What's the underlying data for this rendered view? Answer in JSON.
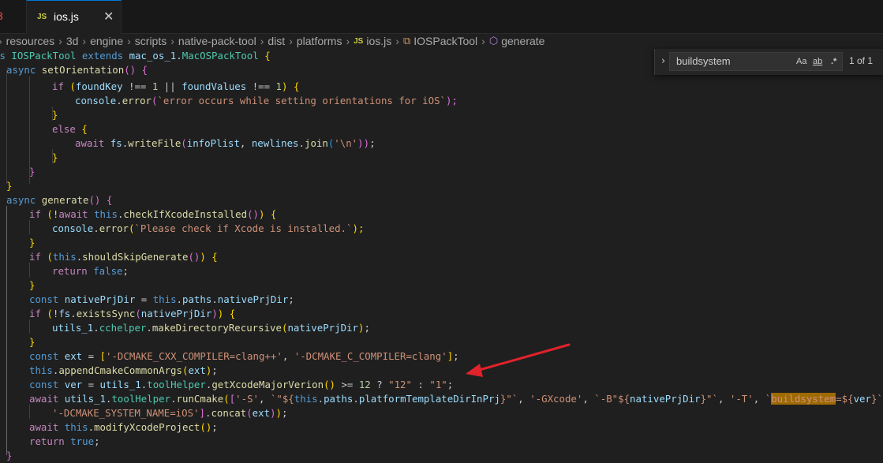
{
  "tabs": {
    "prev_tab_fragment": "3",
    "active": {
      "badge": "JS",
      "label": "ios.js",
      "close": "✕"
    }
  },
  "breadcrumb": {
    "items": [
      "resources",
      "3d",
      "engine",
      "scripts",
      "native-pack-tool",
      "dist",
      "platforms"
    ],
    "file": {
      "badge": "JS",
      "label": "ios.js"
    },
    "class_label": "IOSPackTool",
    "method_label": "generate"
  },
  "find": {
    "value": "buildsystem",
    "match_case": "Aa",
    "whole_word": "ab",
    "regex": ".*",
    "count": "1 of 1"
  },
  "code": {
    "l1": {
      "a": "ss ",
      "b": "IOSPackTool",
      "c": " extends ",
      "d": "mac_os_1",
      "e": ".",
      "f": "MacOSPackTool",
      "g": " {"
    },
    "l2": {
      "a": "async ",
      "b": "setOrientation",
      "c": "() {"
    },
    "l3": {
      "a": "if ",
      "b": "(",
      "c": "foundKey",
      "d": " !== ",
      "e": "1",
      "f": " || ",
      "g": "foundValues",
      "h": " !== ",
      "i": "1",
      "j": ")",
      "k": " {"
    },
    "l4": {
      "a": "console",
      "b": ".",
      "c": "error",
      "d": "(",
      "e": "`error occurs while setting orientations for iOS`",
      "f": ");"
    },
    "l5": {
      "a": "}"
    },
    "l6": {
      "a": "else ",
      "b": "{"
    },
    "l7": {
      "a": "await ",
      "b": "fs",
      "c": ".",
      "d": "writeFile",
      "e": "(",
      "f": "infoPlist",
      "g": ", ",
      "h": "newlines",
      "i": ".",
      "j": "join",
      "k": "(",
      "l": "'\\n'",
      "m": "))",
      "n": ";"
    },
    "l8": {
      "a": "}"
    },
    "l9": {
      "a": "}"
    },
    "l10": {
      "a": "}"
    },
    "l11": {
      "a": "async ",
      "b": "generate",
      "c": "() {"
    },
    "l12": {
      "a": "if ",
      "b": "(",
      "c": "!",
      "d": "await ",
      "e": "this",
      "f": ".",
      "g": "checkIfXcodeInstalled",
      "h": "()",
      "i": ")",
      "j": " {"
    },
    "l13": {
      "a": "console",
      "b": ".",
      "c": "error",
      "d": "(",
      "e": "`Please check if Xcode is installed.`",
      "f": ");"
    },
    "l14": {
      "a": "}"
    },
    "l15": {
      "a": "if ",
      "b": "(",
      "c": "this",
      "d": ".",
      "e": "shouldSkipGenerate",
      "f": "()",
      "g": ")",
      "h": " {"
    },
    "l16": {
      "a": "return ",
      "b": "false",
      "c": ";"
    },
    "l17": {
      "a": "}"
    },
    "l18": {
      "a": "const ",
      "b": "nativePrjDir",
      "c": " = ",
      "d": "this",
      "e": ".",
      "f": "paths",
      "g": ".",
      "h": "nativePrjDir",
      "i": ";"
    },
    "l19": {
      "a": "if ",
      "b": "(",
      "c": "!",
      "d": "fs",
      "e": ".",
      "f": "existsSync",
      "g": "(",
      "h": "nativePrjDir",
      "i": ")",
      "j": ")",
      "k": " {"
    },
    "l20": {
      "a": "utils_1",
      "b": ".",
      "c": "cchelper",
      "d": ".",
      "e": "makeDirectoryRecursive",
      "f": "(",
      "g": "nativePrjDir",
      "h": ")",
      "i": ";"
    },
    "l21": {
      "a": "}"
    },
    "l22": {
      "a": "const ",
      "b": "ext",
      "c": " = ",
      "d": "[",
      "e": "'-DCMAKE_CXX_COMPILER=clang++'",
      "f": ", ",
      "g": "'-DCMAKE_C_COMPILER=clang'",
      "h": "]",
      "i": ";"
    },
    "l23": {
      "a": "this",
      "b": ".",
      "c": "appendCmakeCommonArgs",
      "d": "(",
      "e": "ext",
      "f": ")",
      "g": ";"
    },
    "l24": {
      "a": "const ",
      "b": "ver",
      "c": " = ",
      "d": "utils_1",
      "e": ".",
      "f": "toolHelper",
      "g": ".",
      "h": "getXcodeMajorVerion",
      "i": "()",
      "j": " >= ",
      "k": "12",
      "l": " ? ",
      "m": "\"12\"",
      "n": " : ",
      "o": "\"1\"",
      "p": ";"
    },
    "l25": {
      "a": "await ",
      "b": "utils_1",
      "c": ".",
      "d": "toolHelper",
      "e": ".",
      "f": "runCmake",
      "g": "(",
      "h": "[",
      "i": "'-S'",
      "j": ", ",
      "k": "`\"${",
      "l": "this",
      "m": ".",
      "n": "paths",
      "o": ".",
      "p": "platformTemplateDirInPrj",
      "q": "}\"`",
      "r": ", ",
      "s": "'-GXcode'",
      "t": ", ",
      "u": "`-B\"${",
      "v": "nativePrjDir",
      "w": "}\"`",
      "x": ", ",
      "y": "'-T'",
      "z": ", ",
      "aa": "`",
      "ab": "buildsystem",
      "ac": "=${",
      "ad": "ver",
      "ae": "}`",
      "af": ","
    },
    "l26": {
      "a": "'-DCMAKE_SYSTEM_NAME=iOS'",
      "b": "]",
      "c": ".",
      "d": "concat",
      "e": "(",
      "f": "ext",
      "g": ")",
      "h": ")",
      "i": ";"
    },
    "l27": {
      "a": "await ",
      "b": "this",
      "c": ".",
      "d": "modifyXcodeProject",
      "e": "()",
      "f": ";"
    },
    "l28": {
      "a": "return ",
      "b": "true",
      "c": ";"
    },
    "l29": {
      "a": "}"
    }
  },
  "colors": {
    "arrow": "#e0222b",
    "find_highlight": "#9e6a03",
    "tab_accent": "#0078d4"
  }
}
